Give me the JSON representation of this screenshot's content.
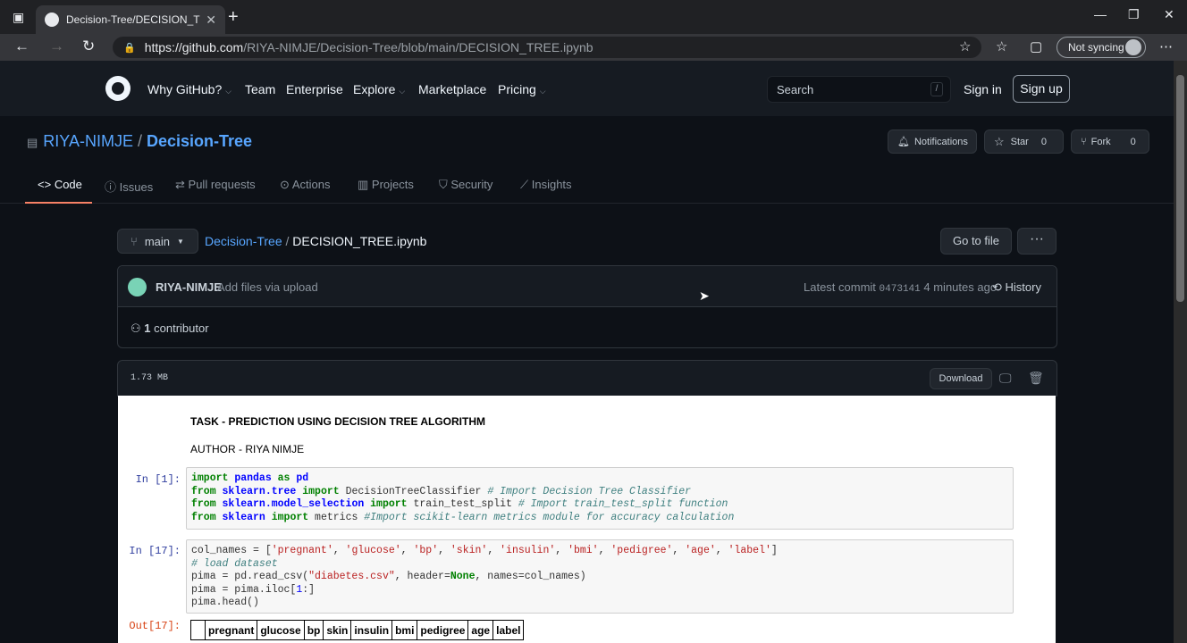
{
  "browser": {
    "tab_title": "Decision-Tree/DECISION_TREE.ipynb",
    "tab_close": "✕",
    "new_tab": "+",
    "url_host": "https://github.com",
    "url_path": "/RIYA-NIMJE/Decision-Tree/blob/main/DECISION_TREE.ipynb",
    "sync_label": "Not syncing"
  },
  "gh_header": {
    "nav": [
      "Why GitHub?",
      "Team",
      "Enterprise",
      "Explore",
      "Marketplace",
      "Pricing"
    ],
    "search_placeholder": "Search",
    "search_key": "/",
    "sign_in": "Sign in",
    "sign_up": "Sign up"
  },
  "repo": {
    "owner": "RIYA-NIMJE",
    "sep": "/",
    "name": "Decision-Tree",
    "notifications": "Notifications",
    "star": "Star",
    "star_count": "0",
    "fork": "Fork",
    "fork_count": "0"
  },
  "repo_tabs": [
    "Code",
    "Issues",
    "Pull requests",
    "Actions",
    "Projects",
    "Security",
    "Insights"
  ],
  "file_nav": {
    "branch": "main",
    "repo_link": "Decision-Tree",
    "sep": "/",
    "file_name": "DECISION_TREE.ipynb",
    "go_to_file": "Go to file",
    "more": "···"
  },
  "commit": {
    "user": "RIYA-NIMJE",
    "message": "Add files via upload",
    "latest_prefix": "Latest commit",
    "sha": "0473141",
    "time": "4 minutes ago",
    "history": "History",
    "contributors_count": "1",
    "contributors_label": "contributor"
  },
  "file": {
    "size": "1.73 MB",
    "download": "Download"
  },
  "notebook": {
    "heading": "TASK - PREDICTION USING DECISION TREE ALGORITHM",
    "author": "AUTHOR - RIYA NIMJE",
    "cell1_prompt": "In [1]:",
    "cell2_prompt": "In [17]:",
    "out_prompt": "Out[17]:",
    "table_headers": [
      "",
      "pregnant",
      "glucose",
      "bp",
      "skin",
      "insulin",
      "bmi",
      "pedigree",
      "age",
      "label"
    ]
  },
  "colors": {
    "bg": "#0d1117",
    "header": "#161b22",
    "link": "#58a6ff",
    "tab_underline": "#f78166"
  }
}
